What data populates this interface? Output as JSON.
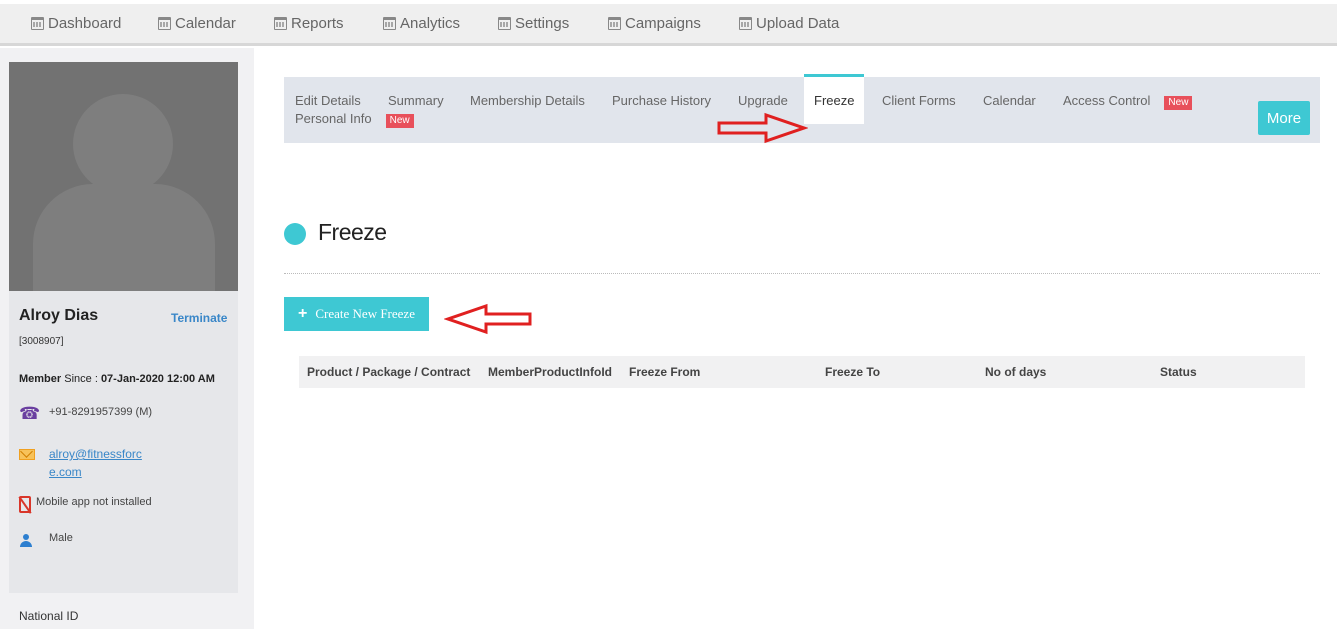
{
  "topnav": {
    "items": [
      {
        "label": "Dashboard",
        "icon": "calendar-icon"
      },
      {
        "label": "Calendar",
        "icon": "calendar-icon"
      },
      {
        "label": "Reports",
        "icon": "calendar-icon"
      },
      {
        "label": "Analytics",
        "icon": "calendar-icon"
      },
      {
        "label": "Settings",
        "icon": "calendar-icon"
      },
      {
        "label": "Campaigns",
        "icon": "calendar-icon"
      },
      {
        "label": "Upload Data",
        "icon": "calendar-icon"
      }
    ]
  },
  "profile": {
    "name": "Alroy Dias",
    "terminate_label": "Terminate",
    "member_id": "[3008907]",
    "since_label": "Member",
    "since_text": " Since : ",
    "since_date": "07-Jan-2020 12:00 AM",
    "phone": "+91-8291957399 (M)",
    "email_line1": "alroy@fitnessforc",
    "email_line2": "e.com",
    "app_status": "Mobile app not installed",
    "gender": "Male",
    "national_id_label": "National ID"
  },
  "tabs": {
    "items": [
      {
        "label": "Edit Details"
      },
      {
        "label": "Summary"
      },
      {
        "label": "Membership Details"
      },
      {
        "label": "Purchase History"
      },
      {
        "label": "Upgrade"
      },
      {
        "label": "Freeze"
      },
      {
        "label": "Client Forms"
      },
      {
        "label": "Calendar"
      },
      {
        "label": "Access Control"
      },
      {
        "label": "Personal Info"
      }
    ],
    "new_badge": "New",
    "active": "Freeze",
    "more_label": "More"
  },
  "main": {
    "section_title": "Freeze",
    "create_button_label": "Create New Freeze",
    "table_headers": [
      "Product / Package / Contract",
      "MemberProductInfoId",
      "Freeze From",
      "Freeze To",
      "No of days",
      "Status"
    ]
  },
  "colors": {
    "accent": "#3ec8d3",
    "badge": "#e8505b",
    "annotation_arrow": "#e02020"
  }
}
